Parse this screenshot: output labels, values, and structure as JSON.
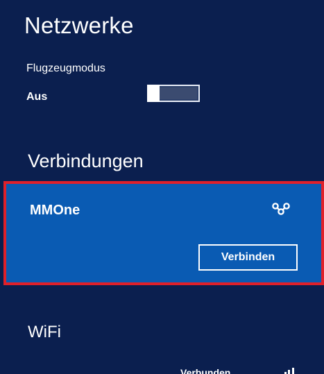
{
  "header": {
    "title": "Netzwerke"
  },
  "airplane_mode": {
    "label": "Flugzeugmodus",
    "state": "Aus",
    "enabled": false
  },
  "connections": {
    "heading": "Verbindungen",
    "items": [
      {
        "name": "MMOne",
        "icon": "mobile-broadband-icon",
        "action_label": "Verbinden",
        "selected": true
      }
    ]
  },
  "wifi": {
    "heading": "WiFi",
    "partial_item": {
      "name": "....",
      "status": "Verbunden",
      "icon": "wifi-signal-icon"
    }
  },
  "colors": {
    "background": "#0b1f4f",
    "selected_card": "#0a5bb3",
    "highlight_border": "#e0202a"
  }
}
